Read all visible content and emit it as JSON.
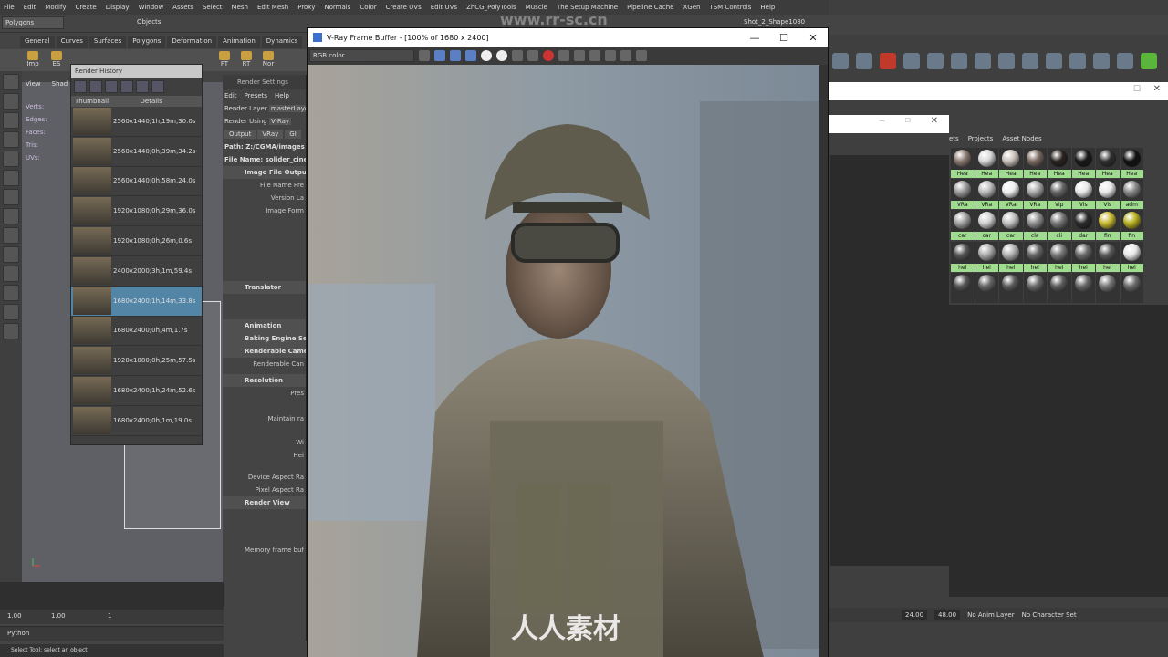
{
  "menubar": [
    "File",
    "Edit",
    "Modify",
    "Create",
    "Display",
    "Window",
    "Assets",
    "Select",
    "Mesh",
    "Edit Mesh",
    "Proxy",
    "Normals",
    "Color",
    "Create UVs",
    "Edit UVs",
    "ZhCG_PolyTools",
    "Muscle",
    "The Setup Machine",
    "Pipeline Cache",
    "XGen",
    "TSM Controls",
    "Help"
  ],
  "status": {
    "mode": "Polygons",
    "objects_label": "Objects",
    "scene_name": "Shot_2_Shape1080"
  },
  "shelf_tabs": [
    "General",
    "Curves",
    "Surfaces",
    "Polygons",
    "Deformation",
    "Animation",
    "Dynamics"
  ],
  "shelf_icons": [
    "Imp",
    "ES",
    "FT",
    "RT",
    "Nor"
  ],
  "hud": [
    "Verts:",
    "Edges:",
    "Faces:",
    "Tris:",
    "UVs:"
  ],
  "viewport_menu": [
    "View",
    "Shad"
  ],
  "render_history": {
    "title": "Render History",
    "col_thumb": "Thumbnail",
    "col_details": "Details",
    "rows": [
      "2560x1440;1h,19m,30.0s",
      "2560x1440;0h,39m,34.2s",
      "2560x1440;0h,58m,24.0s",
      "1920x1080;0h,29m,36.0s",
      "1920x1080;0h,26m,0.6s",
      "2400x2000;3h,1m,59.4s",
      "1680x2400;1h,14m,33.8s",
      "1680x2400;0h,4m,1.7s",
      "1920x1080;0h,25m,57.5s",
      "1680x2400;1h,24m,52.6s",
      "1680x2400;0h,1m,19.0s"
    ],
    "selected_index": 6
  },
  "render_settings": {
    "title": "Render Settings",
    "menu": [
      "Edit",
      "Presets",
      "Help"
    ],
    "render_layer_label": "Render Layer",
    "render_layer_value": "masterLayer",
    "render_using_label": "Render Using",
    "render_using_value": "V-Ray",
    "tabs": [
      "Output",
      "VRay",
      "GI"
    ],
    "path": "Path: Z:/CGMA/images",
    "file_name": "File Name: solider_cinema",
    "sections": {
      "image_file_output": "Image File Output",
      "translator": "Translator",
      "animation": "Animation",
      "baking": "Baking Engine Se",
      "renderable_cam": "Renderable Came",
      "resolution": "Resolution",
      "render_view": "Render View"
    },
    "fields": {
      "file_name_prefix": "File Name Pre",
      "version_label": "Version La",
      "image_format": "Image Form",
      "renderable_camera": "Renderable Can",
      "preset": "Pres",
      "maintain": "Maintain ra",
      "width": "Wi",
      "height": "Hei",
      "device_aspect": "Device Aspect Ra",
      "pixel_aspect": "Pixel Aspect Ra",
      "memory": "Memory frame buf"
    }
  },
  "vfb": {
    "title": "V-Ray Frame Buffer - [100% of 1680 x 2400]",
    "channel": "RGB color",
    "minimize": "—",
    "maximize": "☐",
    "close": "✕"
  },
  "hypershade": {
    "tabs": [
      "ets",
      "Projects",
      "Asset Nodes"
    ],
    "swatch_labels": [
      "Hea",
      "Hea",
      "Hea",
      "Hea",
      "Hea",
      "Hea",
      "Hea",
      "Hea",
      "VRa",
      "VRa",
      "VRa",
      "VRa",
      "Vip",
      "Vis",
      "Vis",
      "adm",
      "car",
      "car",
      "car",
      "cla",
      "cli",
      "dar",
      "fin",
      "fin",
      "hel",
      "hel",
      "hel",
      "hel",
      "hel",
      "hel",
      "hel",
      "hel",
      "",
      "",
      "",
      "",
      "",
      "",
      "",
      ""
    ],
    "swatch_colors": [
      "#8a7a70",
      "#d8d8d8",
      "#c9c0b8",
      "#7a6a60",
      "#2a2220",
      "#1a1818",
      "#303030",
      "#111111",
      "#999999",
      "#bbbbbb",
      "#eeeeee",
      "#aaaaaa",
      "#666666",
      "#e8e8e8",
      "#e8e8e8",
      "#888888",
      "#a0a0a0",
      "#d0d0d0",
      "#c0c0c0",
      "#909090",
      "#777777",
      "#2a2a2a",
      "#c8b830",
      "#b8b020",
      "#555555",
      "#aaaaaa",
      "#b0b0b0",
      "#666666",
      "#777777",
      "#6a6a6a",
      "#5a5a5a",
      "#e8e8e8",
      "#555555",
      "#666666",
      "#5a5a5a",
      "#6a6a6a",
      "#5d5d5d",
      "#666666",
      "#777777",
      "#6a6a6a"
    ]
  },
  "anim_bar": {
    "start": "24.00",
    "end": "48.00",
    "anim_layer": "No Anim Layer",
    "char_set": "No Character Set"
  },
  "range": {
    "start": "1.00",
    "start2": "1.00",
    "mark": "1"
  },
  "cmd": {
    "label": "Python"
  },
  "help": "Select Tool: select an object",
  "watermark": "人人素材",
  "watermark_url": "www.rr-sc.cn"
}
